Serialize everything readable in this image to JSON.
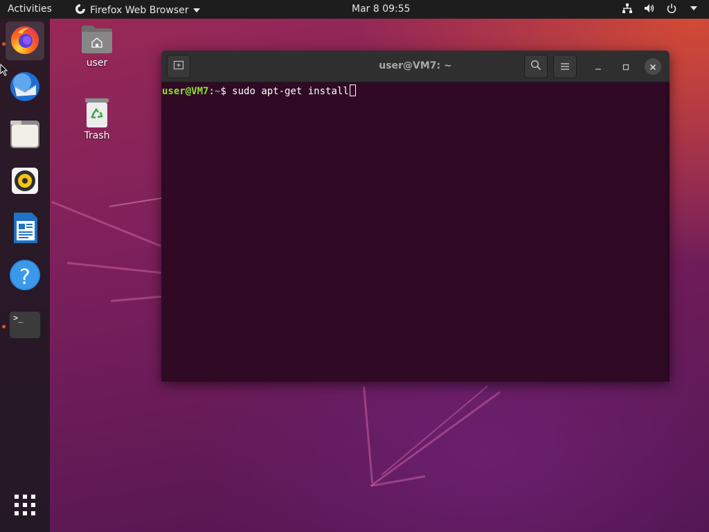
{
  "topbar": {
    "activities": "Activities",
    "app_name": "Firefox Web Browser",
    "clock": "Mar 8  09:55",
    "tray": [
      "network-icon",
      "volume-icon",
      "power-icon",
      "chevron-down-icon"
    ]
  },
  "dock": {
    "items": [
      {
        "name": "firefox",
        "icon": "firefox-icon",
        "active": true,
        "running": true
      },
      {
        "name": "thunderbird",
        "icon": "thunderbird-icon",
        "active": false,
        "running": false
      },
      {
        "name": "files",
        "icon": "files-icon",
        "active": false,
        "running": false
      },
      {
        "name": "rhythmbox",
        "icon": "rhythmbox-icon",
        "active": false,
        "running": false
      },
      {
        "name": "libreoffice-writer",
        "icon": "writer-icon",
        "active": false,
        "running": false
      },
      {
        "name": "help",
        "icon": "help-icon",
        "active": false,
        "running": false
      },
      {
        "name": "terminal",
        "icon": "terminal-icon",
        "active": false,
        "running": true
      }
    ],
    "show_apps": "grid-icon",
    "terminal_glyph": ">_",
    "help_glyph": "?"
  },
  "desktop": {
    "home_label": "user",
    "trash_label": "Trash"
  },
  "terminal": {
    "title": "user@VM7: ~",
    "prompt_user": "user@VM7",
    "prompt_sep": ":",
    "prompt_path": "~",
    "prompt_symbol": "$ ",
    "command": "sudo apt-get install"
  },
  "colors": {
    "accent": "#e95420",
    "terminal_bg": "#300a24",
    "prompt_user": "#8ae234",
    "prompt_path": "#729fcf"
  }
}
